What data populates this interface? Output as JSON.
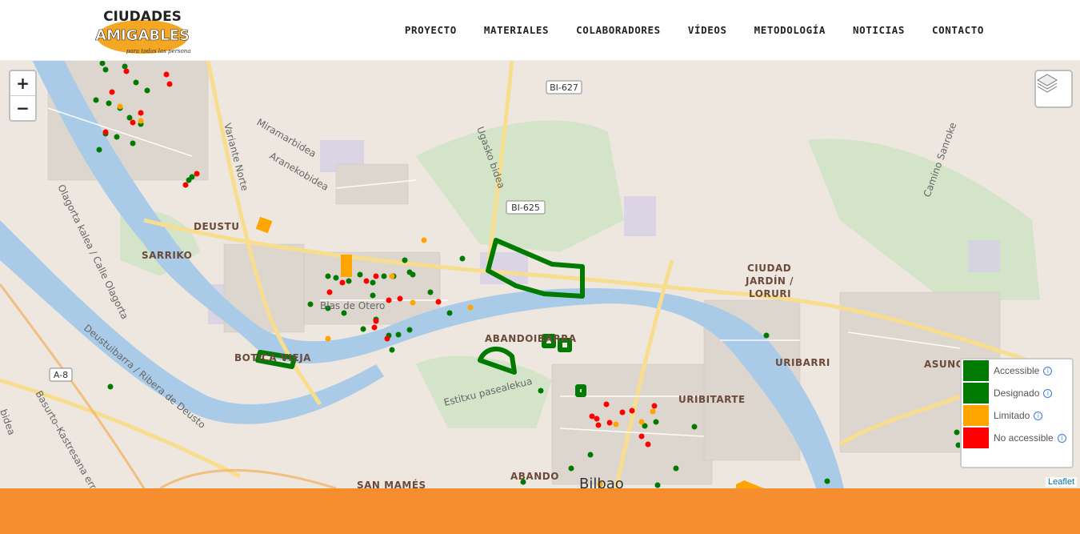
{
  "brand": {
    "logo_line1": "CIUDADES",
    "logo_line2": "AMIGABLES",
    "logo_tagline": "para todas las personas",
    "color_orange": "#f5a623"
  },
  "nav": [
    {
      "label": "PROYECTO"
    },
    {
      "label": "MATERIALES"
    },
    {
      "label": "COLABORADORES"
    },
    {
      "label": "VÍDEOS"
    },
    {
      "label": "METODOLOGÍA"
    },
    {
      "label": "NOTICIAS"
    },
    {
      "label": "CONTACTO"
    }
  ],
  "map": {
    "zoom_in": "+",
    "zoom_out": "−",
    "layers_icon": "layers-icon",
    "attribution": "Leaflet",
    "labels": {
      "deustu": "DEUSTU",
      "sarriko": "SARRIKO",
      "abandoibarra": "ABANDOIBARRA",
      "botica": "BOTICA VIEJA",
      "uribarri": "URIBARRI",
      "ciudad1": "CIUDAD",
      "ciudad2": "JARDÍN /",
      "ciudad3": "LORURI",
      "uribitarte": "URIBITARTE",
      "abando": "ABANDO",
      "sanmames": "SAN MAMÉS",
      "bilbao": "Bilbao",
      "asuncion": "ASUNCIÓN",
      "variante": "Variante Norte",
      "miramar": "Miramarbidea",
      "araneko": "Aranekobidea",
      "ugasko": "Ugasko bidea",
      "olagorta": "Olagorta kalea / Calle Olagorta",
      "deustubarra": "Deustuibarra / Ribera de Deusto",
      "basurto": "Basurto–Kastresana errepidea",
      "estitxu": "Estitxu pasealekua",
      "camino": "Camino Sanroke",
      "blasotero": "Blas de Otero",
      "road_bi627": "BI-627",
      "road_bi625": "BI-625",
      "road_a8": "A-8",
      "bidea": "bidea"
    }
  },
  "legend": [
    {
      "label": "Accessible",
      "color": "#007a00"
    },
    {
      "label": "Designado",
      "color": "#007a00"
    },
    {
      "label": "Limitado",
      "color": "#ffa500"
    },
    {
      "label": "No accessible",
      "color": "#ff0000"
    }
  ],
  "footer": {
    "color": "#f68d2e"
  }
}
